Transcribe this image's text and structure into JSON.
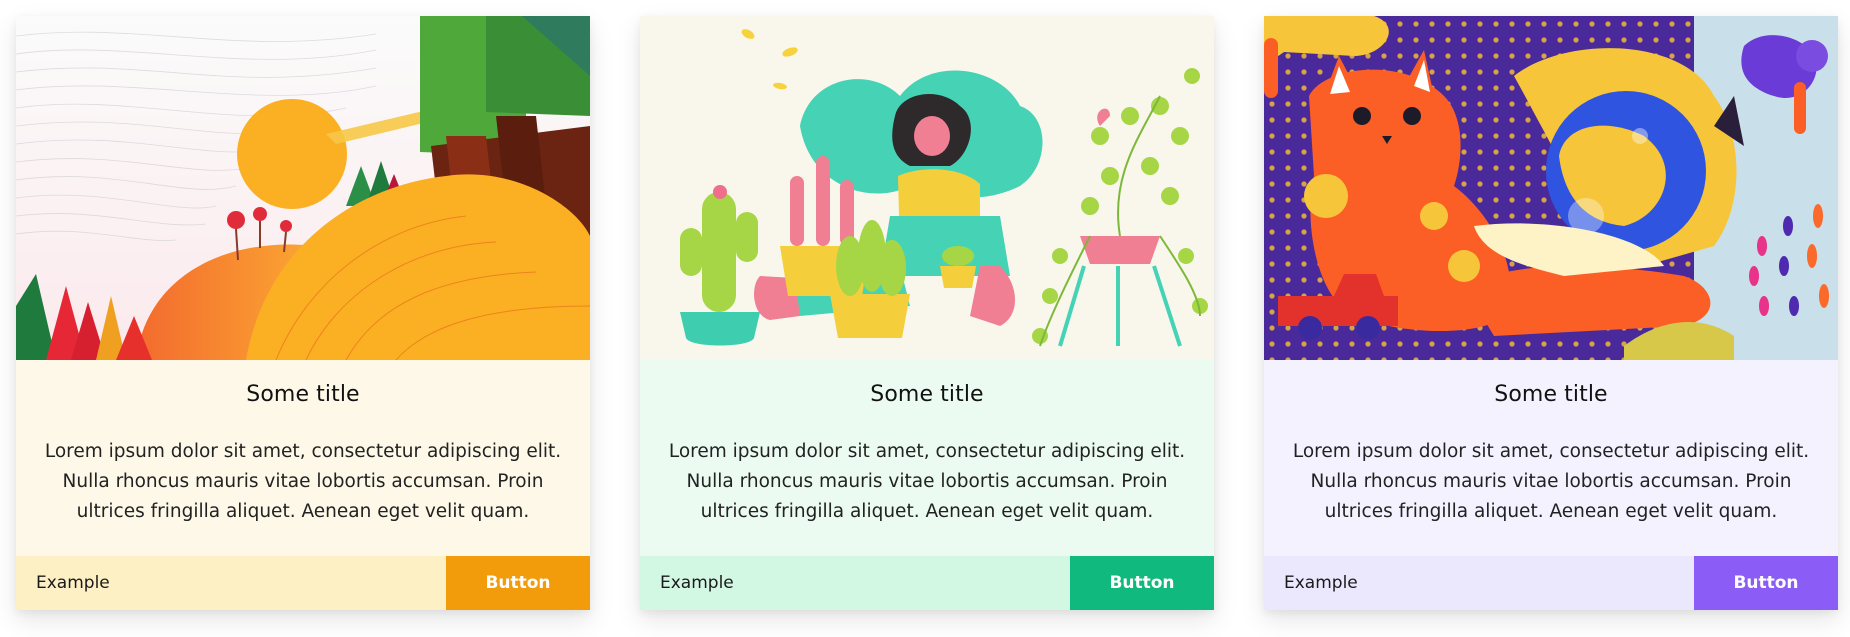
{
  "cards": [
    {
      "title": "Some title",
      "text": "Lorem ipsum dolor sit amet, consectetur adipiscing elit. Nulla rhoncus mauris vitae lobortis accumsan. Proin ultrices fringilla aliquet. Aenean eget velit quam.",
      "footer_text": "Example",
      "button_label": "Button",
      "illustration": "autumn-landscape-illustration",
      "colors": {
        "body_bg": "#fdf8e8",
        "footer_bg": "#fdf0c4",
        "button_bg": "#f29c0c"
      }
    },
    {
      "title": "Some title",
      "text": "Lorem ipsum dolor sit amet, consectetur adipiscing elit. Nulla rhoncus mauris vitae lobortis accumsan. Proin ultrices fringilla aliquet. Aenean eget velit quam.",
      "footer_text": "Example",
      "button_label": "Button",
      "illustration": "woman-with-plants-illustration",
      "colors": {
        "body_bg": "#ebfbf2",
        "footer_bg": "#d2f7e3",
        "button_bg": "#10b97e"
      }
    },
    {
      "title": "Some title",
      "text": "Lorem ipsum dolor sit amet, consectetur adipiscing elit. Nulla rhoncus mauris vitae lobortis accumsan. Proin ultrices fringilla aliquet. Aenean eget velit quam.",
      "footer_text": "Example",
      "button_label": "Button",
      "illustration": "cats-and-fishbowl-illustration",
      "colors": {
        "body_bg": "#f3f2fe",
        "footer_bg": "#ebe8fd",
        "button_bg": "#8b5cf6"
      }
    }
  ]
}
